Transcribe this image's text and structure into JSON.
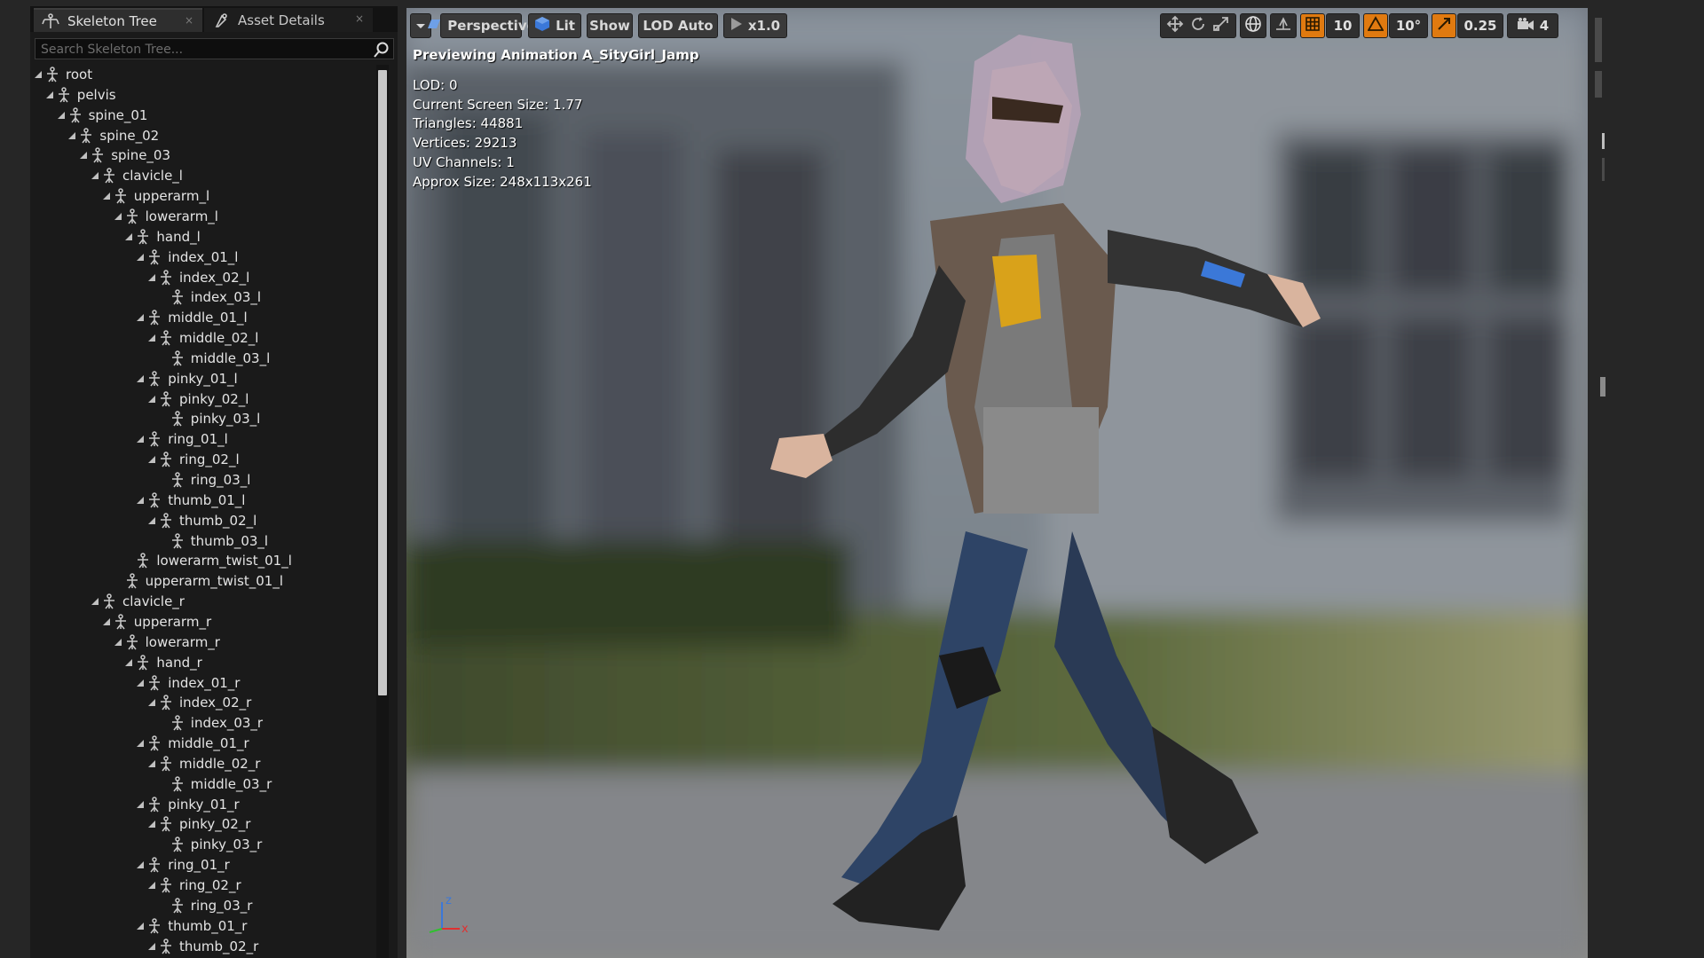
{
  "tabs": {
    "skeleton_tree": "Skeleton Tree",
    "asset_details": "Asset Details",
    "close_glyph": "×"
  },
  "search": {
    "placeholder": "Search Skeleton Tree..."
  },
  "tree": [
    {
      "label": "root",
      "depth": 0,
      "expander": "expanded"
    },
    {
      "label": "pelvis",
      "depth": 1,
      "expander": "expanded"
    },
    {
      "label": "spine_01",
      "depth": 2,
      "expander": "expanded"
    },
    {
      "label": "spine_02",
      "depth": 3,
      "expander": "expanded"
    },
    {
      "label": "spine_03",
      "depth": 4,
      "expander": "expanded"
    },
    {
      "label": "clavicle_l",
      "depth": 5,
      "expander": "expanded"
    },
    {
      "label": "upperarm_l",
      "depth": 6,
      "expander": "expanded"
    },
    {
      "label": "lowerarm_l",
      "depth": 7,
      "expander": "expanded"
    },
    {
      "label": "hand_l",
      "depth": 8,
      "expander": "expanded"
    },
    {
      "label": "index_01_l",
      "depth": 9,
      "expander": "expanded"
    },
    {
      "label": "index_02_l",
      "depth": 10,
      "expander": "expanded"
    },
    {
      "label": "index_03_l",
      "depth": 11,
      "expander": "none"
    },
    {
      "label": "middle_01_l",
      "depth": 9,
      "expander": "expanded"
    },
    {
      "label": "middle_02_l",
      "depth": 10,
      "expander": "expanded"
    },
    {
      "label": "middle_03_l",
      "depth": 11,
      "expander": "none"
    },
    {
      "label": "pinky_01_l",
      "depth": 9,
      "expander": "expanded"
    },
    {
      "label": "pinky_02_l",
      "depth": 10,
      "expander": "expanded"
    },
    {
      "label": "pinky_03_l",
      "depth": 11,
      "expander": "none"
    },
    {
      "label": "ring_01_l",
      "depth": 9,
      "expander": "expanded"
    },
    {
      "label": "ring_02_l",
      "depth": 10,
      "expander": "expanded"
    },
    {
      "label": "ring_03_l",
      "depth": 11,
      "expander": "none"
    },
    {
      "label": "thumb_01_l",
      "depth": 9,
      "expander": "expanded"
    },
    {
      "label": "thumb_02_l",
      "depth": 10,
      "expander": "expanded"
    },
    {
      "label": "thumb_03_l",
      "depth": 11,
      "expander": "none"
    },
    {
      "label": "lowerarm_twist_01_l",
      "depth": 8,
      "expander": "none"
    },
    {
      "label": "upperarm_twist_01_l",
      "depth": 7,
      "expander": "none"
    },
    {
      "label": "clavicle_r",
      "depth": 5,
      "expander": "expanded"
    },
    {
      "label": "upperarm_r",
      "depth": 6,
      "expander": "expanded"
    },
    {
      "label": "lowerarm_r",
      "depth": 7,
      "expander": "expanded"
    },
    {
      "label": "hand_r",
      "depth": 8,
      "expander": "expanded"
    },
    {
      "label": "index_01_r",
      "depth": 9,
      "expander": "expanded"
    },
    {
      "label": "index_02_r",
      "depth": 10,
      "expander": "expanded"
    },
    {
      "label": "index_03_r",
      "depth": 11,
      "expander": "none"
    },
    {
      "label": "middle_01_r",
      "depth": 9,
      "expander": "expanded"
    },
    {
      "label": "middle_02_r",
      "depth": 10,
      "expander": "expanded"
    },
    {
      "label": "middle_03_r",
      "depth": 11,
      "expander": "none"
    },
    {
      "label": "pinky_01_r",
      "depth": 9,
      "expander": "expanded"
    },
    {
      "label": "pinky_02_r",
      "depth": 10,
      "expander": "expanded"
    },
    {
      "label": "pinky_03_r",
      "depth": 11,
      "expander": "none"
    },
    {
      "label": "ring_01_r",
      "depth": 9,
      "expander": "expanded"
    },
    {
      "label": "ring_02_r",
      "depth": 10,
      "expander": "expanded"
    },
    {
      "label": "ring_03_r",
      "depth": 11,
      "expander": "none"
    },
    {
      "label": "thumb_01_r",
      "depth": 9,
      "expander": "expanded"
    },
    {
      "label": "thumb_02_r",
      "depth": 10,
      "expander": "expanded"
    }
  ],
  "toolbar": {
    "dropdown_icon": "chevron-down-icon",
    "perspective": "Perspective",
    "lit": "Lit",
    "show": "Show",
    "lod": "LOD Auto",
    "playback": "x1.0",
    "grid_snap_value": "10",
    "rotation_snap_value": "10°",
    "scale_snap_value": "0.25",
    "camera_speed_value": "4"
  },
  "viewport_info": {
    "previewing": "Previewing Animation A_SityGirl_Jamp",
    "lod": "LOD: 0",
    "screen_size": "Current Screen Size: 1.77",
    "triangles": "Triangles: 44881",
    "vertices": "Vertices: 29213",
    "uv_channels": "UV Channels: 1",
    "approx_size": "Approx Size: 248x113x261"
  },
  "axis": {
    "x_label": "x",
    "z_label": "z"
  },
  "colors": {
    "accent_orange": "#e07a10",
    "lit_blue": "#3b78d8",
    "perspective_blue": "#6ea0e8"
  },
  "tree_scroll": {
    "visible_fraction": 0.7
  }
}
